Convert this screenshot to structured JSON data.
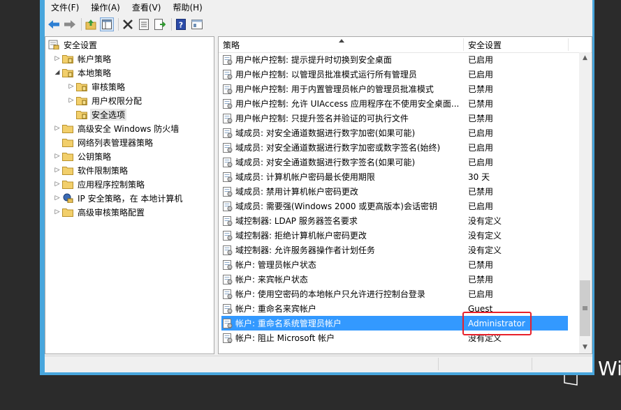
{
  "menubar": {
    "items": [
      {
        "label": "文件(F)"
      },
      {
        "label": "操作(A)"
      },
      {
        "label": "查看(V)"
      },
      {
        "label": "帮助(H)"
      }
    ]
  },
  "toolbar": {
    "icons": [
      "back-arrow-icon",
      "forward-arrow-icon",
      "up-folder-icon",
      "show-hide-tree-icon",
      "delete-icon",
      "properties-icon",
      "export-list-icon",
      "help-icon",
      "mmc-view-icon"
    ]
  },
  "tree": {
    "root": "安全设置",
    "items": [
      {
        "label": "帐户策略",
        "expander": "▷"
      },
      {
        "label": "本地策略",
        "expander": "◢"
      },
      {
        "label": "审核策略",
        "expander": "▷"
      },
      {
        "label": "用户权限分配",
        "expander": "▷"
      },
      {
        "label": "安全选项",
        "expander": ""
      },
      {
        "label": "高级安全 Windows 防火墙",
        "expander": "▷"
      },
      {
        "label": "网络列表管理器策略",
        "expander": ""
      },
      {
        "label": "公钥策略",
        "expander": "▷"
      },
      {
        "label": "软件限制策略",
        "expander": "▷"
      },
      {
        "label": "应用程序控制策略",
        "expander": "▷"
      },
      {
        "label": "IP 安全策略，在 本地计算机",
        "expander": "▷"
      },
      {
        "label": "高级审核策略配置",
        "expander": "▷"
      }
    ]
  },
  "list": {
    "columns": {
      "policy": "策略",
      "setting": "安全设置"
    },
    "rows": [
      {
        "policy": "用户帐户控制: 提示提升时切换到安全桌面",
        "setting": "已启用"
      },
      {
        "policy": "用户帐户控制: 以管理员批准模式运行所有管理员",
        "setting": "已启用"
      },
      {
        "policy": "用户帐户控制: 用于内置管理员帐户的管理员批准模式",
        "setting": "已禁用"
      },
      {
        "policy": "用户帐户控制: 允许 UIAccess 应用程序在不使用安全桌面...",
        "setting": "已禁用"
      },
      {
        "policy": "用户帐户控制: 只提升签名并验证的可执行文件",
        "setting": "已禁用"
      },
      {
        "policy": "域成员: 对安全通道数据进行数字加密(如果可能)",
        "setting": "已启用"
      },
      {
        "policy": "域成员: 对安全通道数据进行数字加密或数字签名(始终)",
        "setting": "已启用"
      },
      {
        "policy": "域成员: 对安全通道数据进行数字签名(如果可能)",
        "setting": "已启用"
      },
      {
        "policy": "域成员: 计算机帐户密码最长使用期限",
        "setting": "30 天"
      },
      {
        "policy": "域成员: 禁用计算机帐户密码更改",
        "setting": "已禁用"
      },
      {
        "policy": "域成员: 需要强(Windows 2000 或更高版本)会话密钥",
        "setting": "已启用"
      },
      {
        "policy": "域控制器: LDAP 服务器签名要求",
        "setting": "没有定义"
      },
      {
        "policy": "域控制器: 拒绝计算机帐户密码更改",
        "setting": "没有定义"
      },
      {
        "policy": "域控制器: 允许服务器操作者计划任务",
        "setting": "没有定义"
      },
      {
        "policy": "帐户: 管理员帐户状态",
        "setting": "已禁用"
      },
      {
        "policy": "帐户: 来宾帐户状态",
        "setting": "已禁用"
      },
      {
        "policy": "帐户: 使用空密码的本地帐户只允许进行控制台登录",
        "setting": "已启用"
      },
      {
        "policy": "帐户: 重命名来宾帐户",
        "setting": "Guest"
      },
      {
        "policy": "帐户: 重命名系统管理员帐户",
        "setting": "Administrator"
      },
      {
        "policy": "帐户: 阻止 Microsoft 帐户",
        "setting": "没有定义"
      }
    ]
  },
  "desktop": {
    "watermark": "Win"
  },
  "colors": {
    "selection": "#3399ff",
    "highlight_box": "#e8202a",
    "window_border": "#48a6dd"
  }
}
